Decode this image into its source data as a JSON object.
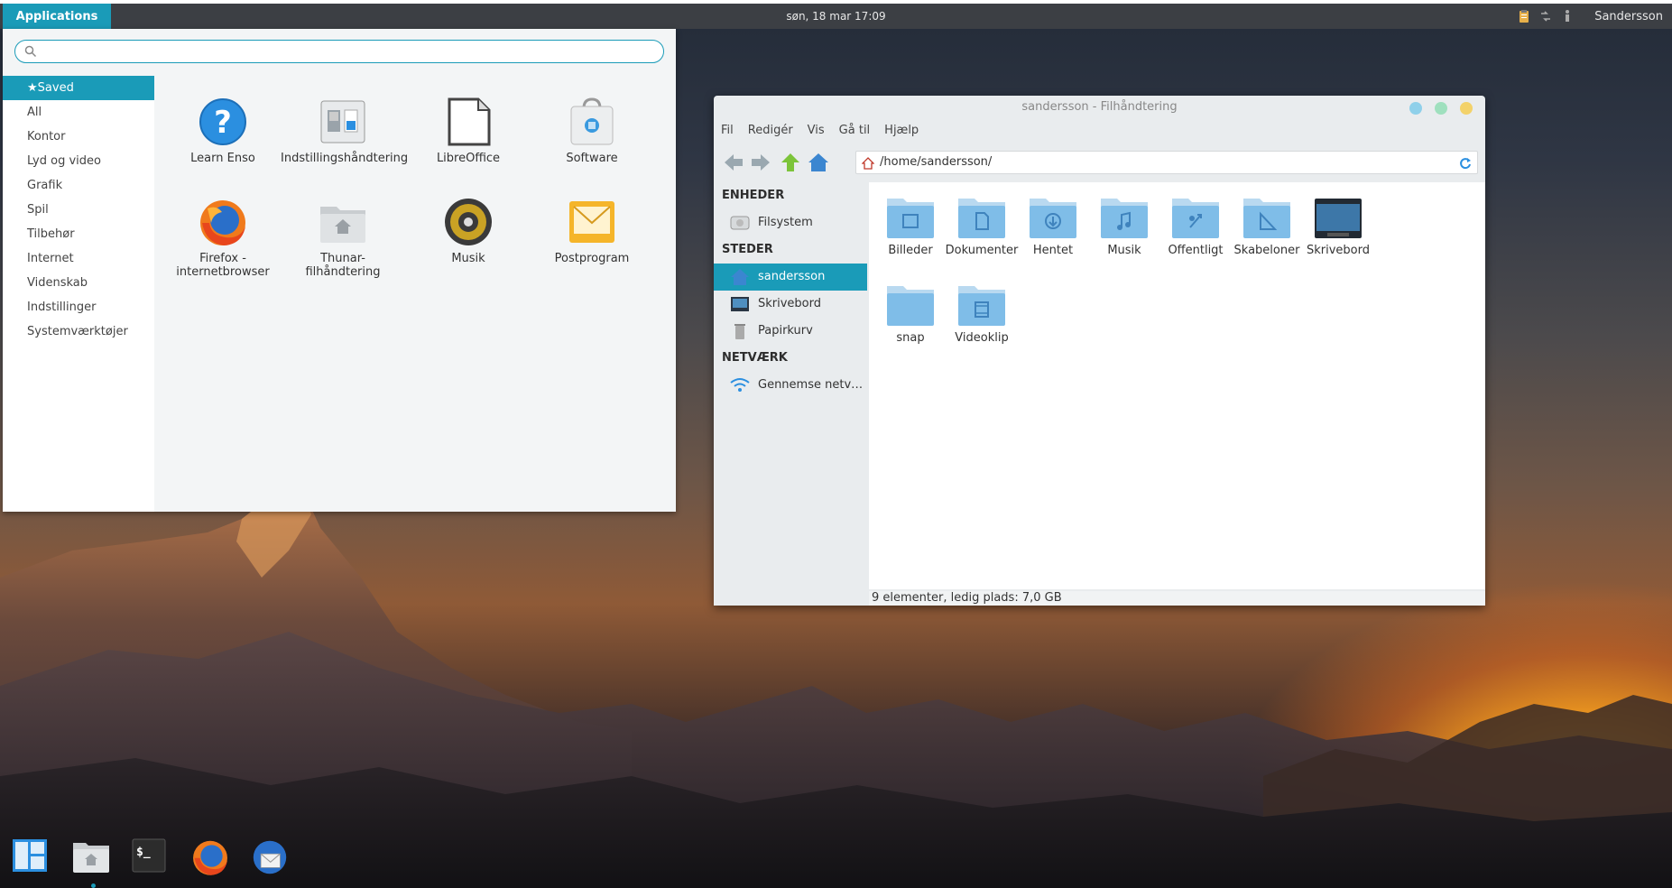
{
  "colors": {
    "accent": "#1a9bb8",
    "panel": "#3c3f44",
    "folder": "#8cc4ea"
  },
  "top_panel": {
    "applications_label": "Applications",
    "clock": "søn, 18 mar  17:09",
    "user": "Sandersson",
    "tray_icons": [
      "clipboard-icon",
      "network-icon",
      "accessibility-icon"
    ]
  },
  "app_menu": {
    "search": {
      "value": "",
      "placeholder": ""
    },
    "categories": [
      {
        "label": "★Saved"
      },
      {
        "label": "All"
      },
      {
        "label": "Kontor"
      },
      {
        "label": "Lyd og video"
      },
      {
        "label": "Grafik"
      },
      {
        "label": "Spil"
      },
      {
        "label": "Tilbehør"
      },
      {
        "label": "Internet"
      },
      {
        "label": "Videnskab"
      },
      {
        "label": "Indstillinger"
      },
      {
        "label": "Systemværktøjer"
      }
    ],
    "apps": [
      {
        "label": "Learn Enso",
        "icon": "help-icon"
      },
      {
        "label": "Indstillingshåndtering",
        "icon": "settings-manager-icon"
      },
      {
        "label": "LibreOffice",
        "icon": "libreoffice-icon"
      },
      {
        "label": "Software",
        "icon": "software-store-icon"
      },
      {
        "label": "Firefox -",
        "label2": "internetbrowser",
        "icon": "firefox-icon"
      },
      {
        "label": "Thunar-",
        "label2": "filhåndtering",
        "icon": "file-manager-icon"
      },
      {
        "label": "Musik",
        "icon": "speaker-icon"
      },
      {
        "label": "Postprogram",
        "icon": "mail-icon"
      }
    ]
  },
  "file_manager": {
    "title": "sandersson - Filhåndtering",
    "menu": [
      "Fil",
      "Redigér",
      "Vis",
      "Gå til",
      "Hjælp"
    ],
    "path": "/home/sandersson/",
    "sidebar": {
      "devices_heading": "ENHEDER",
      "devices": [
        {
          "label": "Filsystem",
          "icon": "harddisk-icon"
        }
      ],
      "places_heading": "STEDER",
      "places": [
        {
          "label": "sandersson",
          "icon": "home-icon"
        },
        {
          "label": "Skrivebord",
          "icon": "desktop-icon"
        },
        {
          "label": "Papirkurv",
          "icon": "trash-icon"
        }
      ],
      "network_heading": "NETVÆRK",
      "network": [
        {
          "label": "Gennemse netv…",
          "icon": "wifi-icon"
        }
      ]
    },
    "items": [
      {
        "label": "Billeder",
        "icon": "pictures-folder-icon"
      },
      {
        "label": "Dokumenter",
        "icon": "documents-folder-icon"
      },
      {
        "label": "Hentet",
        "icon": "downloads-folder-icon"
      },
      {
        "label": "Musik",
        "icon": "music-folder-icon"
      },
      {
        "label": "Offentligt",
        "icon": "public-folder-icon"
      },
      {
        "label": "Skabeloner",
        "icon": "templates-folder-icon"
      },
      {
        "label": "Skrivebord",
        "icon": "desktop-folder-icon"
      },
      {
        "label": "snap",
        "icon": "folder-icon"
      },
      {
        "label": "Videoklip",
        "icon": "videos-folder-icon"
      }
    ],
    "status": "9 elementer, ledig plads: 7,0 GB"
  },
  "dock": [
    {
      "name": "workspaces-icon"
    },
    {
      "name": "file-manager-icon"
    },
    {
      "name": "terminal-icon"
    },
    {
      "name": "firefox-icon"
    },
    {
      "name": "thunderbird-icon"
    }
  ]
}
